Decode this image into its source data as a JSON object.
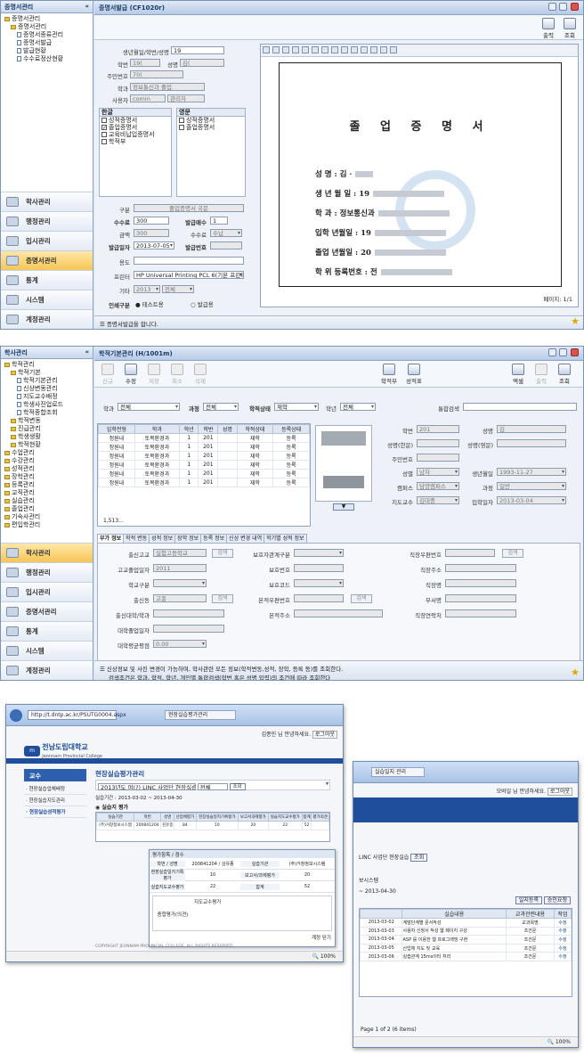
{
  "s1": {
    "sidebar_title": "증명서관리",
    "collapse_glyph": "«",
    "tree": [
      {
        "label": "증명서관리",
        "depth": 0,
        "kind": "folder"
      },
      {
        "label": "증명서관리",
        "depth": 1,
        "kind": "folder"
      },
      {
        "label": "증명서종류관리",
        "depth": 2,
        "kind": "doc"
      },
      {
        "label": "증명서발급",
        "depth": 2,
        "kind": "doc"
      },
      {
        "label": "발급현황",
        "depth": 2,
        "kind": "doc"
      },
      {
        "label": "수수료정산현황",
        "depth": 2,
        "kind": "doc"
      }
    ],
    "nav": [
      "학사관리",
      "행정관리",
      "입시관리",
      "증명서관리",
      "통계",
      "시스템",
      "계정관리"
    ],
    "nav_selected": 3,
    "window_title": "증명서발급 (CF1020r)",
    "toolbar": {
      "print": "출력",
      "search": "조회"
    },
    "form": {
      "birth_label": "생년월일/학번/성명",
      "birth_value": "19",
      "id_label": "학번",
      "id_value": "19(",
      "name_label": "성명",
      "name_value": "김(",
      "rrn_label": "주민번호",
      "rrn_value": "70(",
      "dept_label": "학과",
      "dept_value": "정보통신과 졸업",
      "user_label": "사용자",
      "user_id": "comin",
      "user_role": "관리자",
      "korean_label": "한글",
      "english_label": "영문",
      "korean_items": [
        {
          "label": "성적증명서",
          "checked": false
        },
        {
          "label": "졸업증명서",
          "checked": true
        },
        {
          "label": "교육비납입증명서",
          "checked": false
        },
        {
          "label": "학적부",
          "checked": false
        }
      ],
      "english_items": [
        {
          "label": "성적증명서",
          "checked": false
        },
        {
          "label": "졸업증명서",
          "checked": false
        }
      ],
      "kind_label": "구분",
      "kind_value": "졸업증명서 국문",
      "fee_label": "수수료",
      "fee_value": "300",
      "copies_label": "발급매수",
      "copies_value": "1",
      "amount_label": "금액",
      "amount_value": "300",
      "fee2_label": "수수료",
      "fee2_value": "수납",
      "date_label": "발급일자",
      "date_value": "2013-07-05",
      "no_label": "발급번호",
      "no_value": "",
      "purpose_label": "용도",
      "purpose_value": "",
      "printer_label": "프린터",
      "printer_value": "HP Universal Printing PCL 6(기본 프린터",
      "etc_label": "기타",
      "etc_year": "2013",
      "etc_term": "전체",
      "print_mode_label": "인쇄구분",
      "print_mode_test": "테스트용",
      "print_mode_issue": "발급용"
    },
    "document": {
      "title": "졸 업 증 명 서",
      "rows": [
        {
          "label": "성          명 :",
          "value": "김 ·"
        },
        {
          "label": "생 년 월 일 :",
          "value": "19"
        },
        {
          "label": "학          과 :",
          "value": "정보통신과"
        },
        {
          "label": "입학   년월일 :",
          "value": "19"
        },
        {
          "label": "졸업   년월일 :",
          "value": "20"
        },
        {
          "label": "학 위 등록번호 :",
          "value": "전"
        }
      ],
      "page_indicator": "페이지: 1/1"
    },
    "status": "증명서발급을 합니다."
  },
  "s2": {
    "sidebar_title": "학사관리",
    "collapse_glyph": "«",
    "tree": [
      {
        "label": "학적관리",
        "depth": 0,
        "kind": "folder"
      },
      {
        "label": "학적기본",
        "depth": 1,
        "kind": "folder"
      },
      {
        "label": "학적기본관리",
        "depth": 2,
        "kind": "doc"
      },
      {
        "label": "신상변동관리",
        "depth": 2,
        "kind": "doc"
      },
      {
        "label": "지도교수배정",
        "depth": 2,
        "kind": "doc"
      },
      {
        "label": "학생사진업로드",
        "depth": 2,
        "kind": "doc"
      },
      {
        "label": "학적종합조회",
        "depth": 2,
        "kind": "doc"
      },
      {
        "label": "학적변동",
        "depth": 1,
        "kind": "folder"
      },
      {
        "label": "진급관리",
        "depth": 1,
        "kind": "folder"
      },
      {
        "label": "학생생활",
        "depth": 1,
        "kind": "folder"
      },
      {
        "label": "학적현황",
        "depth": 1,
        "kind": "folder"
      },
      {
        "label": "수업관리",
        "depth": 0,
        "kind": "folder"
      },
      {
        "label": "수강관리",
        "depth": 0,
        "kind": "folder"
      },
      {
        "label": "성적관리",
        "depth": 0,
        "kind": "folder"
      },
      {
        "label": "장학관리",
        "depth": 0,
        "kind": "folder"
      },
      {
        "label": "등록관리",
        "depth": 0,
        "kind": "folder"
      },
      {
        "label": "교직관리",
        "depth": 0,
        "kind": "folder"
      },
      {
        "label": "실습관리",
        "depth": 0,
        "kind": "folder"
      },
      {
        "label": "졸업관리",
        "depth": 0,
        "kind": "folder"
      },
      {
        "label": "기숙사관리",
        "depth": 0,
        "kind": "folder"
      },
      {
        "label": "편입학관리",
        "depth": 0,
        "kind": "folder"
      }
    ],
    "nav": [
      "학사관리",
      "행정관리",
      "입시관리",
      "증명서관리",
      "통계",
      "시스템",
      "계정관리"
    ],
    "nav_selected": 0,
    "window_title": "학적기본관리 (H/1001m)",
    "toolbar_left": [
      "신규",
      "수정",
      "저장",
      "취소",
      "삭제"
    ],
    "toolbar_right": [
      "학적부",
      "성적표"
    ],
    "toolbar_far": [
      "엑셀",
      "출력",
      "조회"
    ],
    "filters": {
      "dept_label": "학과",
      "dept_value": "전체",
      "course_label": "과정",
      "course_value": "전체",
      "status_label": "학적상태",
      "status_value": "재학",
      "year_label": "학년",
      "year_value": "전체",
      "search_label": "통합검색",
      "search_value": ""
    },
    "grid": {
      "columns": [
        "입학전형",
        "학과",
        "학년",
        "학번",
        "성명",
        "학적상태",
        "등록상태"
      ],
      "rows": [
        [
          "정원내",
          "토목환경과",
          "1",
          "201",
          "",
          "재학",
          "등록"
        ],
        [
          "정원내",
          "토목환경과",
          "1",
          "201",
          "",
          "재학",
          "등록"
        ],
        [
          "정원내",
          "토목환경과",
          "1",
          "201",
          "",
          "재학",
          "등록"
        ],
        [
          "정원내",
          "토목환경과",
          "1",
          "201",
          "",
          "재학",
          "등록"
        ],
        [
          "정원내",
          "토목환경과",
          "1",
          "201",
          "",
          "재학",
          "등록"
        ],
        [
          "정원내",
          "토목환경과",
          "1",
          "201",
          "",
          "재학",
          "등록"
        ]
      ],
      "footer": "1,513..."
    },
    "detail": {
      "id_label": "학번",
      "id_value": "201",
      "name_label": "성명",
      "name_value": "김",
      "name_hanja_label": "성명(한문)",
      "name_eng_label": "성명(영문)",
      "rrn_label": "주민번호",
      "rrn_value": "",
      "gender_label": "성별",
      "gender_value": "남자",
      "birth_label": "생년월일",
      "birth_value": "1993-11-27",
      "campus_label": "캠퍼스",
      "campus_value": "담양캠퍼스",
      "course_label": "과정",
      "course_value": "일반",
      "advisor_label": "지도교수",
      "advisor_value": "김대중",
      "entry_label": "입학일자",
      "entry_value": "2013-03-04"
    },
    "tabs": [
      "부가 정보",
      "학적 변동",
      "성적 정보",
      "장학 정보",
      "등록 정보",
      "신상 변경 내역",
      "학기별 성적 정보"
    ],
    "subform": {
      "school_label": "출신고교",
      "school_value": "실험고등학교",
      "grad_label": "고교졸업일자",
      "grad_value": "2011",
      "type_label": "학교구분",
      "type_value": "",
      "region_label": "출신동",
      "region_value": "고흥",
      "univ_label": "출신대학/학과",
      "univ_grad_label": "대학졸업일자",
      "gpa_label": "대학평균평점",
      "gpa_value": "0.00",
      "guardian_type_label": "보호자관계구분",
      "guardian_no_label": "보호번호",
      "guardian_code_label": "보호코드",
      "home_zip_label": "본적우편번호",
      "home_addr_label": "본적주소",
      "work_zip_label": "직장우편번호",
      "work_addr_label": "직장주소",
      "work_name_label": "직장명",
      "dept_label": "부서명",
      "work_tel_label": "직장연락처",
      "search_btn": "검색"
    },
    "status_line1": "신상정보 및 사진 변경이 가능하며, 학사관련 모든 정보(학적변동,성적, 장학, 등록 등)를 조회한다.",
    "status_line2": "검색조건은 학과, 학적, 학년, 개인별 통합검색(학번 혹은 성명 입력)의 조건에 따라 조회한다"
  },
  "s3": {
    "browser1": {
      "address": "http://t.dntp.ac.kr/PSUTG0004.aspx",
      "tab_title": "현장실습평가관리",
      "org_name": "전남도립대학교",
      "org_name_en": "Jeonnam Provincial College",
      "user_greeting": "김종민 님 안녕하세요.",
      "logout": "로그아웃",
      "section": "교수",
      "menu": [
        "현장실습업체배정",
        "현장실습지도관리",
        "현장실습성적평가"
      ],
      "page_title": "현장실습평가관리",
      "filter_year": "2013년도 여(?) LINC 사업단 현장실습",
      "filter_all": "전체",
      "search_btn": "조회",
      "period": "실습기간 : 2013-03-02 ~ 2013-04-30",
      "tab": "실습지 평가",
      "table_headers": [
        "실습기관",
        "학번",
        "성명",
        "산업체평가",
        "현장실습일지기록평가",
        "보고서과제평가",
        "실습지도교수평가",
        "합계",
        "평가의견"
      ],
      "row": [
        "(주)거창정보시스템",
        "200841204",
        "김유종",
        "84",
        "10",
        "20",
        "22",
        "52",
        ""
      ],
      "popup_title": "평가항목 / 점수",
      "popup_rows": [
        {
          "label": "학번 / 성명",
          "value": "200841204 / 김유종",
          "label2": "실습기관",
          "value2": "(주)거창정보시스템"
        },
        {
          "label": "현장실습일지기록평가",
          "value": "10",
          "label2": "보고서/과제평가",
          "value2": "20"
        },
        {
          "label": "실습지도교수평가",
          "value": "22",
          "label2": "합계",
          "value2": "52"
        }
      ],
      "opinion_label": "종합평가(의견)",
      "opinion_value": "지도교수평가",
      "close": "계정 닫기",
      "footer": "COPYRIGHT JEONNAM PROVINCIAL COLLEGE. ALL RIGHTS RESERVED.",
      "zoom": "100%"
    },
    "browser2": {
      "tab_title": "실습일지 관리",
      "user_greeting": "모바일 님 안녕하세요.",
      "logout": "로그아웃",
      "filter": "LINC 사업단 현장실습",
      "search_btn": "조회",
      "company": "보시스템",
      "period": "~ 2013-04-30",
      "btn_register": "일지등록",
      "btn_confirm": "승인요청",
      "table_headers": [
        "실습내용",
        "교과관련내용",
        "작업"
      ],
      "rows": [
        {
          "date": "2013-03-02",
          "content": "계발단계별 문서작성",
          "course": "교과목명",
          "action": "수정"
        },
        {
          "date": "2013-03-03",
          "content": "사용자 신청서 작성 웹 페이지 구성",
          "course": "조건문",
          "action": "수정"
        },
        {
          "date": "2013-03-04",
          "content": "ASP 를 이용한 웹 프로그래밍 구현",
          "course": "조건문",
          "action": "수정"
        },
        {
          "date": "2013-03-05",
          "content": "산업체 지도 및 교육",
          "course": "조건문",
          "action": "수정"
        },
        {
          "date": "2013-03-06",
          "content": "실습관계 15ms이터 처리",
          "course": "조건문",
          "action": "수정"
        }
      ],
      "pager": "Page 1 of 2 (6 items)",
      "zoom": "100%"
    }
  }
}
